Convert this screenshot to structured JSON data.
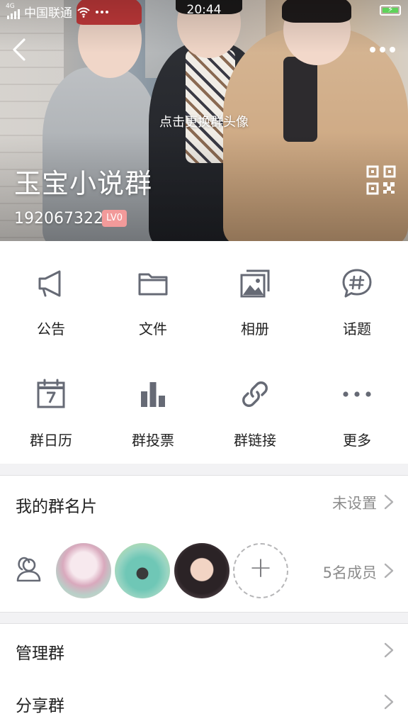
{
  "status_bar": {
    "carrier": "中国联通",
    "network": "4G",
    "time": "20:44",
    "icons": [
      "signal-icon",
      "wifi-icon",
      "dots-icon",
      "battery-charging-icon"
    ]
  },
  "header": {
    "change_avatar_hint": "点击更换群头像",
    "group_name": "玉宝小说群",
    "group_id": "192067322",
    "level_badge": "LV0",
    "icons": [
      "back-icon",
      "more-icon",
      "qr-code-icon"
    ]
  },
  "features": [
    {
      "label": "公告",
      "icon": "megaphone-icon"
    },
    {
      "label": "文件",
      "icon": "folder-icon"
    },
    {
      "label": "相册",
      "icon": "album-icon"
    },
    {
      "label": "话题",
      "icon": "topic-icon"
    },
    {
      "label": "群日历",
      "icon": "calendar-icon"
    },
    {
      "label": "群投票",
      "icon": "vote-icon"
    },
    {
      "label": "群链接",
      "icon": "link-icon"
    },
    {
      "label": "更多",
      "icon": "more-dots-icon"
    }
  ],
  "my_card": {
    "title": "我的群名片",
    "value": "未设置"
  },
  "members": {
    "count_label": "5名成员",
    "add_symbol": "+",
    "icon": "members-icon"
  },
  "manage": {
    "title": "管理群"
  },
  "share": {
    "title": "分享群"
  },
  "colors": {
    "accent_badge": "#f29a9a",
    "text": "#222222",
    "secondary_text": "#8c8c8c",
    "divider": "#e1e1e3",
    "icon": "#666a75"
  }
}
